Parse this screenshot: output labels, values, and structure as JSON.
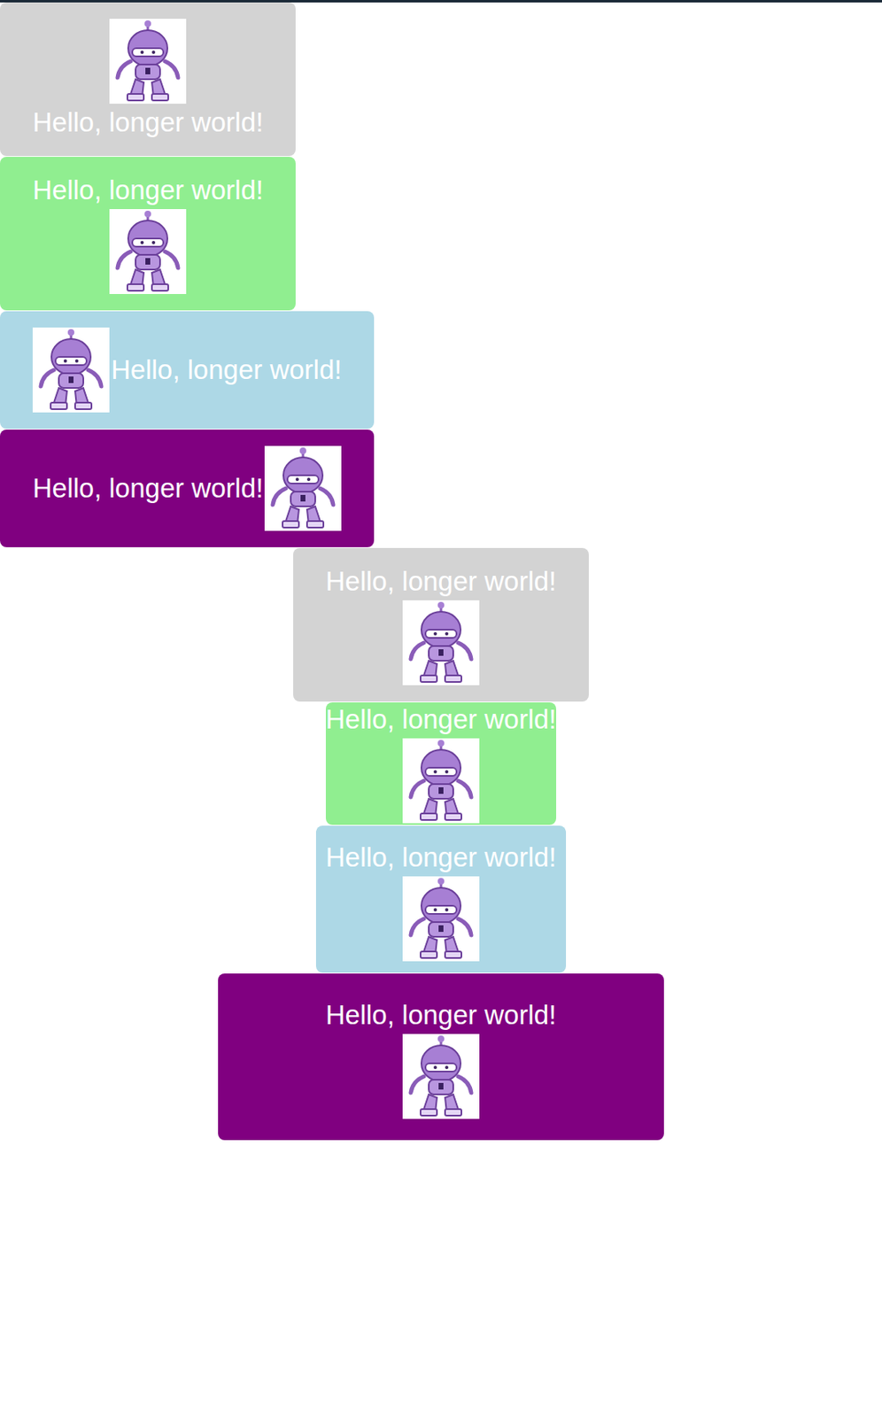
{
  "groups": [
    {
      "buttons": [
        {
          "text": "Hello, longer world!",
          "kind": "top",
          "color": "#d3d3d3"
        },
        {
          "text": "Hello, longer world!",
          "kind": "bottom",
          "color": "#90ee90"
        },
        {
          "text": "Hello, longer world!",
          "kind": "left",
          "color": "#add8e6"
        },
        {
          "text": "Hello, longer world!",
          "kind": "right",
          "color": "#800080"
        }
      ]
    },
    {
      "buttons": [
        {
          "text": "Hello, longer world!",
          "kind": "bottom",
          "color": "#d3d3d3"
        },
        {
          "text": "Hello, longer world!",
          "kind": "bottom",
          "color": "#90ee90"
        },
        {
          "text": "Hello, longer world!",
          "kind": "bottom",
          "color": "#add8e6"
        },
        {
          "text": "Hello, longer world!",
          "kind": "bottom",
          "color": "#800080"
        }
      ]
    }
  ]
}
